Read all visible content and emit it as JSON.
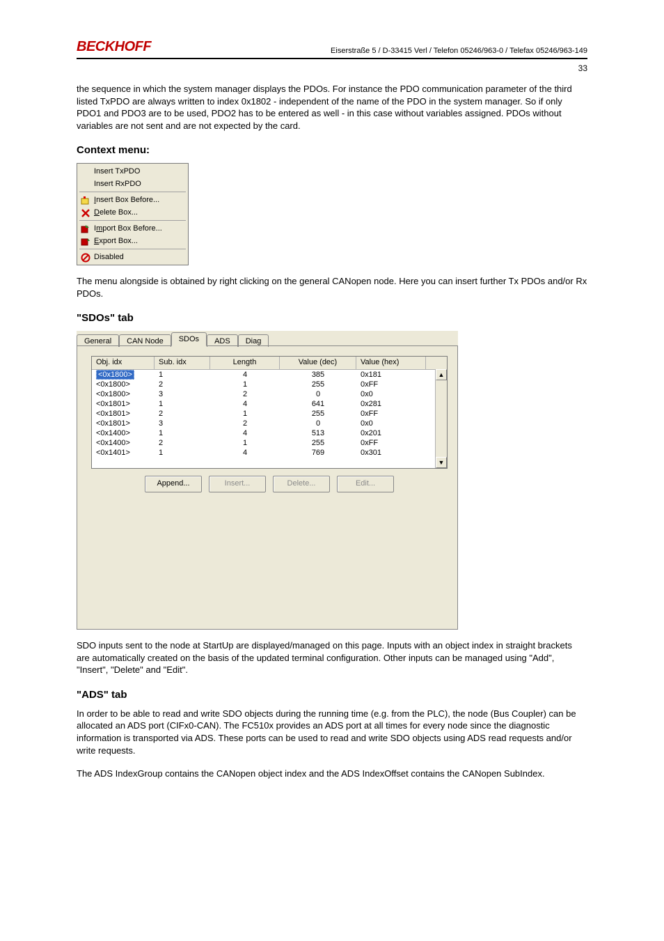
{
  "header": {
    "brand": "BECKHOFF",
    "address": "Eiserstraße 5 / D-33415 Verl / Telefon 05246/963-0 / Telefax 05246/963-149",
    "page_number": "33"
  },
  "intro_paragraph": "the sequence in which the system manager displays the PDOs.  For instance the PDO communication parameter of the third listed TxPDO are always written to index 0x1802 - independent of the name of the PDO in the system manager. So if only PDO1 and PDO3 are to be used, PDO2 has to be entered as well - in this case without variables assigned. PDOs without variables are not sent and are not expected by the card.",
  "context_menu_heading": "Context menu:",
  "context_menu": {
    "items": [
      {
        "label": "Insert TxPDO",
        "icon": ""
      },
      {
        "label": "Insert RxPDO",
        "icon": ""
      }
    ],
    "items2": [
      {
        "prefix": "I",
        "rest": "nsert Box Before...",
        "icon": "yellow-box"
      },
      {
        "prefix": "D",
        "rest": "elete Box...",
        "icon": "red-x"
      }
    ],
    "items3": [
      {
        "prefix": "I",
        "mid": "m",
        "rest": "port Box Before...",
        "icon": "import"
      },
      {
        "prefix": "E",
        "rest": "xport Box...",
        "icon": "export"
      }
    ],
    "items4": [
      {
        "label": "Disabled",
        "icon": "disabled"
      }
    ]
  },
  "context_menu_paragraph": "The menu alongside is obtained by right clicking on the general CANopen node. Here you can insert further Tx PDOs and/or Rx PDOs.",
  "sdos_heading": "\"SDOs\" tab",
  "tabs": {
    "general": "General",
    "can_node": "CAN Node",
    "sdos": "SDOs",
    "ads": "ADS",
    "diag": "Diag"
  },
  "sdo_table": {
    "headers": {
      "obj": "Obj. idx",
      "sub": "Sub. idx",
      "length": "Length",
      "valdec": "Value (dec)",
      "valhex": "Value (hex)"
    },
    "rows": [
      {
        "obj": "<0x1800>",
        "sub": "1",
        "len": "4",
        "vdec": "385",
        "vhex": "0x181",
        "selected": true
      },
      {
        "obj": "<0x1800>",
        "sub": "2",
        "len": "1",
        "vdec": "255",
        "vhex": "0xFF"
      },
      {
        "obj": "<0x1800>",
        "sub": "3",
        "len": "2",
        "vdec": "0",
        "vhex": "0x0"
      },
      {
        "obj": "<0x1801>",
        "sub": "1",
        "len": "4",
        "vdec": "641",
        "vhex": "0x281"
      },
      {
        "obj": "<0x1801>",
        "sub": "2",
        "len": "1",
        "vdec": "255",
        "vhex": "0xFF"
      },
      {
        "obj": "<0x1801>",
        "sub": "3",
        "len": "2",
        "vdec": "0",
        "vhex": "0x0"
      },
      {
        "obj": "<0x1400>",
        "sub": "1",
        "len": "4",
        "vdec": "513",
        "vhex": "0x201"
      },
      {
        "obj": "<0x1400>",
        "sub": "2",
        "len": "1",
        "vdec": "255",
        "vhex": "0xFF"
      },
      {
        "obj": "<0x1401>",
        "sub": "1",
        "len": "4",
        "vdec": "769",
        "vhex": "0x301"
      }
    ],
    "buttons": {
      "append": "Append...",
      "insert": "Insert...",
      "delete": "Delete...",
      "edit": "Edit..."
    }
  },
  "sdos_paragraph": "SDO inputs sent to the node at StartUp are displayed/managed on this page. Inputs with an object index in straight brackets are automatically created on the basis of the updated terminal configuration. Other inputs can be managed using \"Add\", \"Insert\", \"Delete\" and \"Edit\".",
  "ads_heading": "\"ADS\" tab",
  "ads_paragraph1": "In order to be able to read and write SDO objects during the running time (e.g. from the PLC), the node (Bus Coupler) can be allocated an ADS port (CIFx0-CAN). The FC510x provides an ADS port at all times for every node since the diagnostic information is transported via ADS. These ports can be used to read and write SDO objects using ADS read requests and/or write requests.",
  "ads_paragraph2": "The ADS IndexGroup contains the CANopen object index and the ADS IndexOffset contains the CANopen SubIndex."
}
